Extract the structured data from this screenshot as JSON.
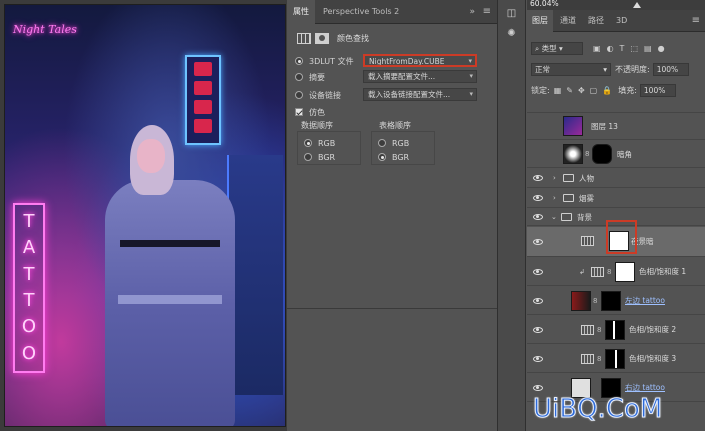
{
  "canvas": {
    "neon_top_text": "Night Tales",
    "tattoo_letters": [
      "T",
      "A",
      "T",
      "T",
      "O",
      "O"
    ]
  },
  "properties_panel": {
    "tabs": [
      "属性",
      "Perspective Tools 2"
    ],
    "collapse_glyph": "»",
    "menu_glyph": "≡",
    "title": "颜色查找",
    "options": [
      {
        "label": "3DLUT 文件",
        "value": "NightFromDay.CUBE",
        "selected": true
      },
      {
        "label": "摘要",
        "value": "载入摘要配置文件...",
        "selected": false
      },
      {
        "label": "设备链接",
        "value": "载入设备链接配置文件...",
        "selected": false
      }
    ],
    "dither_label": "仿色",
    "data_order_label": "数据顺序",
    "table_order_label": "表格顺序",
    "data_order_options": [
      "RGB",
      "BGR"
    ],
    "table_order_options": [
      "RGB",
      "BGR"
    ],
    "data_order_selected": "RGB",
    "table_order_selected": "BGR",
    "bottom_icons": [
      "clip-to-layer-icon",
      "view-previous-icon",
      "reset-icon",
      "visibility-icon",
      "delete-icon"
    ],
    "bottom_glyphs": [
      "⬚",
      "↺",
      "↶",
      "◉",
      "🗑"
    ]
  },
  "toolstrip": {
    "icons": [
      "history-icon",
      "adjustments-icon"
    ],
    "glyphs": [
      "◫",
      "✺"
    ]
  },
  "layers_panel": {
    "zoom": "60.04%",
    "tabs": [
      "图层",
      "通道",
      "路径",
      "3D"
    ],
    "filter_label": "类型",
    "blend_mode": "正常",
    "opacity_label": "不透明度:",
    "opacity_value": "100%",
    "lock_label": "锁定:",
    "fill_label": "填充:",
    "fill_value": "100%",
    "layers": [
      {
        "name": "图层 13",
        "visible": false
      },
      {
        "name": "暗角",
        "visible": false
      },
      {
        "name": "人物",
        "visible": true,
        "group": true
      },
      {
        "name": "烟雾",
        "visible": true,
        "group": true
      },
      {
        "name": "背景",
        "visible": true,
        "group": true,
        "open": true
      },
      {
        "name": "夜景暗",
        "visible": true,
        "selected": true
      },
      {
        "name": "色相/饱和度 1",
        "visible": true
      },
      {
        "name": "左边 tattoo",
        "visible": true
      },
      {
        "name": "色相/饱和度 2",
        "visible": true
      },
      {
        "name": "色相/饱和度 3",
        "visible": true
      },
      {
        "name": "右边 tattoo",
        "visible": true
      }
    ]
  },
  "watermark": "UiBQ.CoM",
  "accent_color": "#cc3b26"
}
